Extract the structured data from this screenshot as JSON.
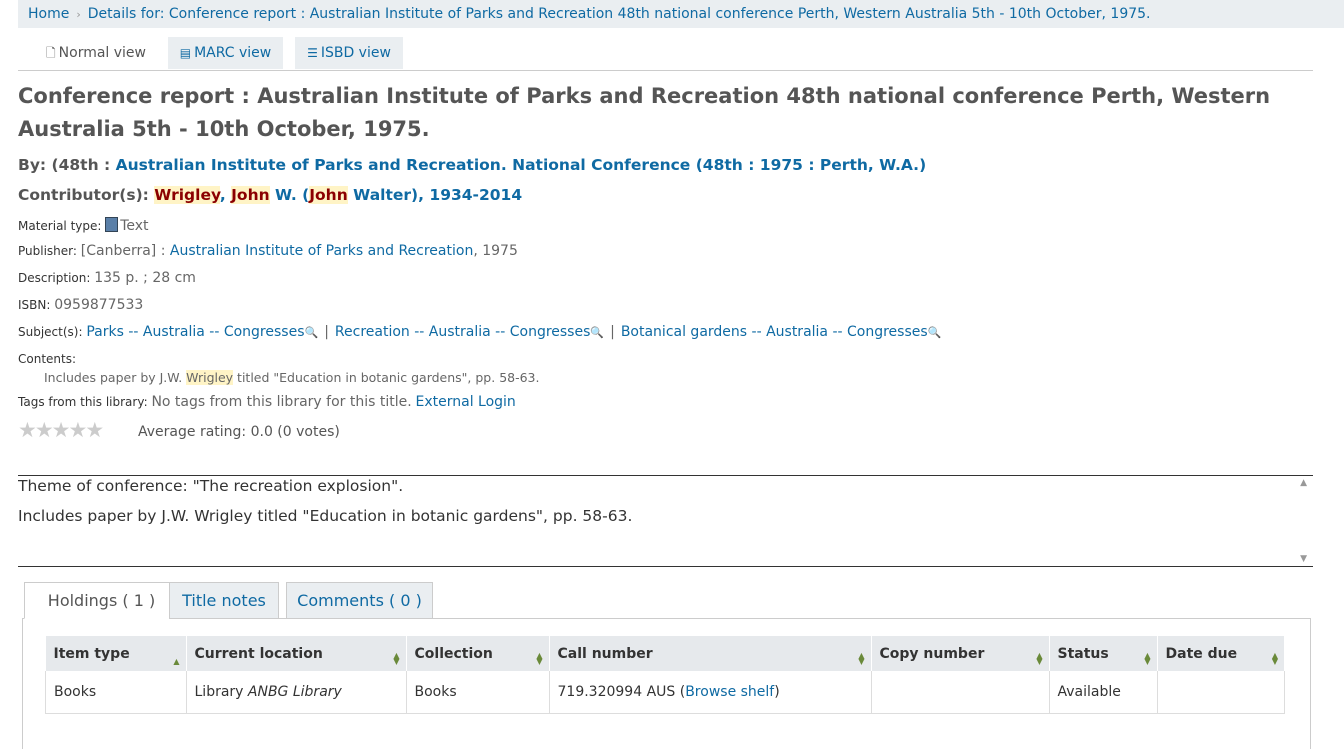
{
  "breadcrumb": {
    "home": "Home",
    "current": "Details for: Conference report : Australian Institute of Parks and Recreation 48th national conference Perth, Western Australia 5th - 10th October, 1975."
  },
  "view_tabs": {
    "normal": "Normal view",
    "marc": "MARC view",
    "isbd": "ISBD view"
  },
  "record": {
    "title": "Conference report : Australian Institute of Parks and Recreation 48th national conference Perth, Western Australia 5th - 10th October, 1975.",
    "by_label": "By: (48th : ",
    "by_link": "Australian Institute of Parks and Recreation. National Conference (48th : 1975 : Perth, W.A.)",
    "contrib_label": "Contributor(s): ",
    "contrib_hl1": "Wrigley",
    "contrib_sep1": ", ",
    "contrib_hl2": "John",
    "contrib_mid": " W. (",
    "contrib_hl3": "John",
    "contrib_tail": " Walter), 1934-2014",
    "material_label": "Material type: ",
    "material_value": "Text",
    "publisher_label": "Publisher: ",
    "publisher_place": "[Canberra] : ",
    "publisher_name": "Australian Institute of Parks and Recreation",
    "publisher_year": ", 1975",
    "description_label": "Description: ",
    "description_value": "135 p. ; 28 cm",
    "isbn_label": "ISBN: ",
    "isbn_value": "0959877533",
    "subjects_label": "Subject(s): ",
    "subjects": [
      "Parks -- Australia -- Congresses",
      "Recreation -- Australia -- Congresses",
      "Botanical gardens -- Australia -- Congresses"
    ],
    "contents_label": "Contents:",
    "contents_pre": "Includes paper by J.W. ",
    "contents_hl": "Wrigley",
    "contents_post": " titled \"Education in botanic gardens\", pp. 58-63.",
    "tags_label": "Tags from this library: ",
    "tags_value": "No tags from this library for this title.",
    "tags_login": "External Login",
    "rating_text": "Average rating: 0.0 (0 votes)",
    "rating_stars": 0
  },
  "notes": {
    "line1": "Theme of conference: \"The recreation explosion\".",
    "line2": "Includes paper by J.W. Wrigley titled \"Education in botanic gardens\", pp. 58-63."
  },
  "holdings_tabs": {
    "holdings": "Holdings ( 1 )",
    "title_notes": "Title notes",
    "comments": "Comments ( 0 )"
  },
  "holdings_table": {
    "headers": [
      "Item type",
      "Current location",
      "Collection",
      "Call number",
      "Copy number",
      "Status",
      "Date due"
    ],
    "row": {
      "item_type": "Books",
      "location_prefix": "Library ",
      "location_name": "ANBG Library",
      "collection": "Books",
      "call_number": "719.320994 AUS (",
      "browse": "Browse shelf",
      "call_close": ")",
      "copy_number": "",
      "status": "Available",
      "date_due": ""
    }
  },
  "colors": {
    "link": "#0f6aa3",
    "highlight": "#fff4c6",
    "available": "#3a7a2a"
  }
}
